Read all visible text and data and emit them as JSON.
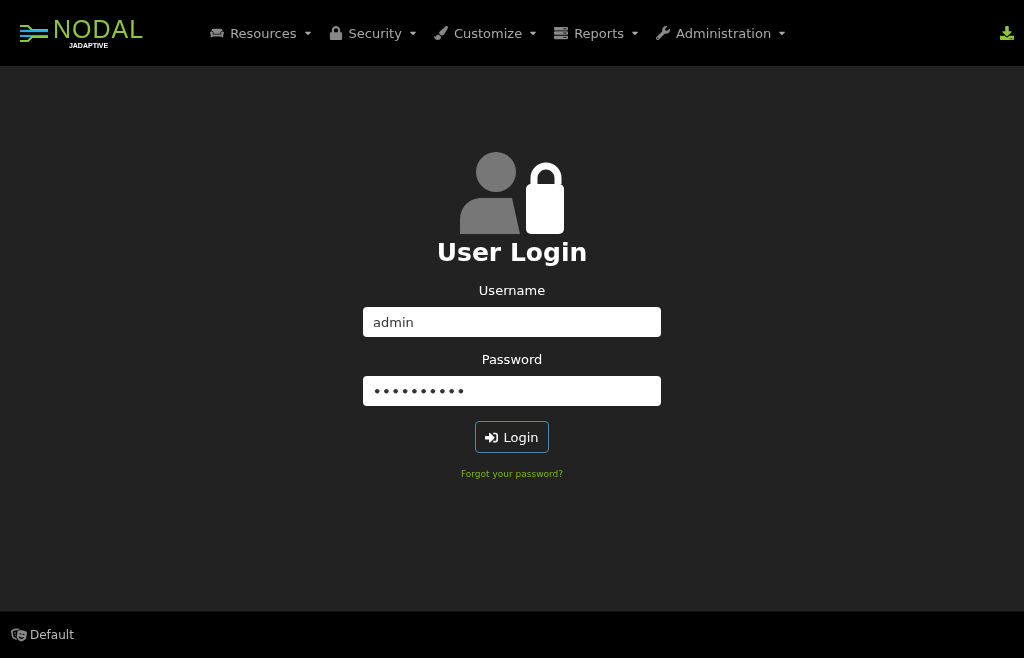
{
  "header": {
    "logo": {
      "name": "NODAL",
      "vendor": "JADAPTIVE"
    },
    "nav": [
      {
        "label": "Resources"
      },
      {
        "label": "Security"
      },
      {
        "label": "Customize"
      },
      {
        "label": "Reports"
      },
      {
        "label": "Administration"
      }
    ]
  },
  "login": {
    "title": "User Login",
    "fields": [
      {
        "label": "Username",
        "value": "admin",
        "kind": "text"
      },
      {
        "label": "Password",
        "value": "••••••••••",
        "kind": "password"
      }
    ],
    "button": "Login",
    "forgot_link": "Forgot your password?"
  },
  "footer": {
    "theme": "Default"
  }
}
